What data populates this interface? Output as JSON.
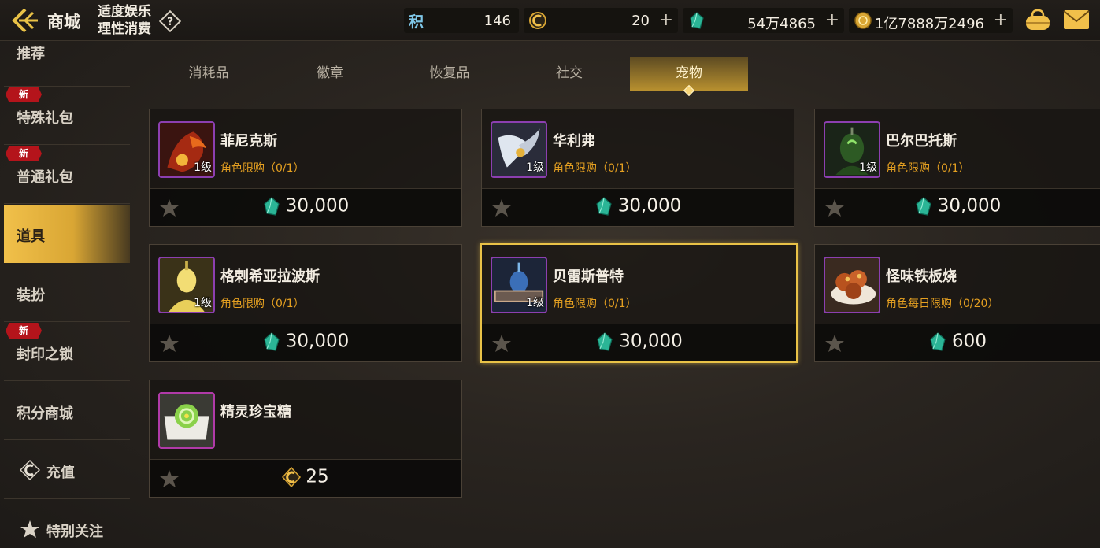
{
  "header": {
    "title": "商城",
    "notice_line1": "适度娱乐",
    "notice_line2": "理性消费",
    "currencies": [
      {
        "icon": "points-icon",
        "label": "积",
        "value": "146"
      },
      {
        "icon": "ceras-icon",
        "value": "20"
      },
      {
        "icon": "gem-icon",
        "value": "54万4865"
      },
      {
        "icon": "gold-coin-icon",
        "value": "1亿7888万2496"
      }
    ]
  },
  "sidebar": {
    "items": [
      {
        "label": "推荐",
        "new": false
      },
      {
        "label": "特殊礼包",
        "new": true
      },
      {
        "label": "普通礼包",
        "new": true
      },
      {
        "label": "道具",
        "new": false,
        "active": true
      },
      {
        "label": "装扮",
        "new": false
      },
      {
        "label": "封印之锁",
        "new": true
      },
      {
        "label": "积分商城",
        "new": false
      },
      {
        "label": "充值",
        "new": false,
        "icon": "ceras-icon"
      },
      {
        "label": "特别关注",
        "new": false,
        "icon": "star-icon"
      }
    ],
    "new_badge": "新"
  },
  "tabs": [
    {
      "label": "消耗品",
      "active": false
    },
    {
      "label": "徽章",
      "active": false
    },
    {
      "label": "恢复品",
      "active": false
    },
    {
      "label": "社交",
      "active": false
    },
    {
      "label": "宠物",
      "active": true
    }
  ],
  "items": [
    {
      "name": "菲尼克斯",
      "level": "1级",
      "limit": "角色限购（0/1）",
      "price": "30,000",
      "currency": "gem-icon"
    },
    {
      "name": "华利弗",
      "level": "1级",
      "limit": "角色限购（0/1）",
      "price": "30,000",
      "currency": "gem-icon"
    },
    {
      "name": "巴尔巴托斯",
      "level": "1级",
      "limit": "角色限购（0/1）",
      "price": "30,000",
      "currency": "gem-icon"
    },
    {
      "name": "格剌希亚拉波斯",
      "level": "1级",
      "limit": "角色限购（0/1）",
      "price": "30,000",
      "currency": "gem-icon"
    },
    {
      "name": "贝雷斯普特",
      "level": "1级",
      "limit": "角色限购（0/1）",
      "price": "30,000",
      "currency": "gem-icon",
      "selected": true
    },
    {
      "name": "怪味铁板烧",
      "level": "",
      "limit": "角色每日限购（0/20）",
      "price": "600",
      "currency": "gem-icon"
    },
    {
      "name": "精灵珍宝糖",
      "level": "",
      "limit": "",
      "price": "25",
      "currency": "ceras-icon"
    }
  ],
  "colors": {
    "accent_gold": "#e9c247",
    "limit_orange": "#e5a021",
    "new_red": "#b4141b",
    "rarity_purple": "#8c3fb0"
  }
}
